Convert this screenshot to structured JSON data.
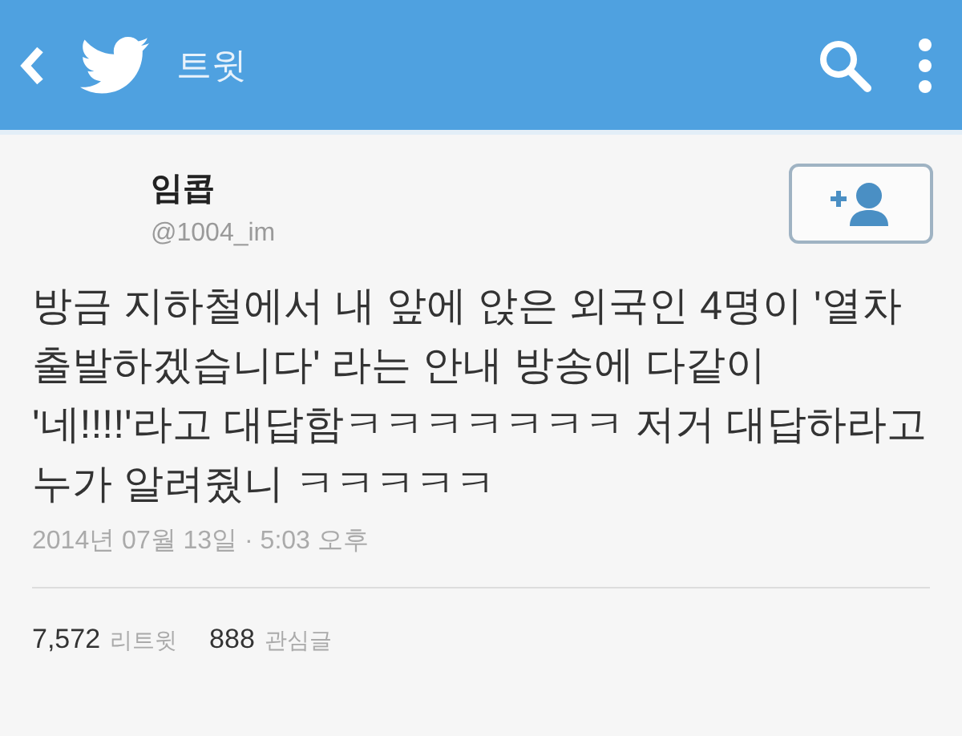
{
  "app_bar": {
    "title": "트윗"
  },
  "author": {
    "name": "임콥",
    "handle": "@1004_im"
  },
  "tweet": {
    "text": "방금 지하철에서 내 앞에 앉은 외국인 4명이 '열차\n출발하겠습니다' 라는 안내 방송에 다같이\n'네!!!!'라고 대답함ㅋㅋㅋㅋㅋㅋㅋ 저거 대답하라고\n누가 알려줬니 ㅋㅋㅋㅋㅋ",
    "timestamp": "2014년 07월 13일 · 5:03 오후"
  },
  "stats": [
    {
      "count": "7,572",
      "label": "리트윗"
    },
    {
      "count": "888",
      "label": "관심글"
    }
  ]
}
